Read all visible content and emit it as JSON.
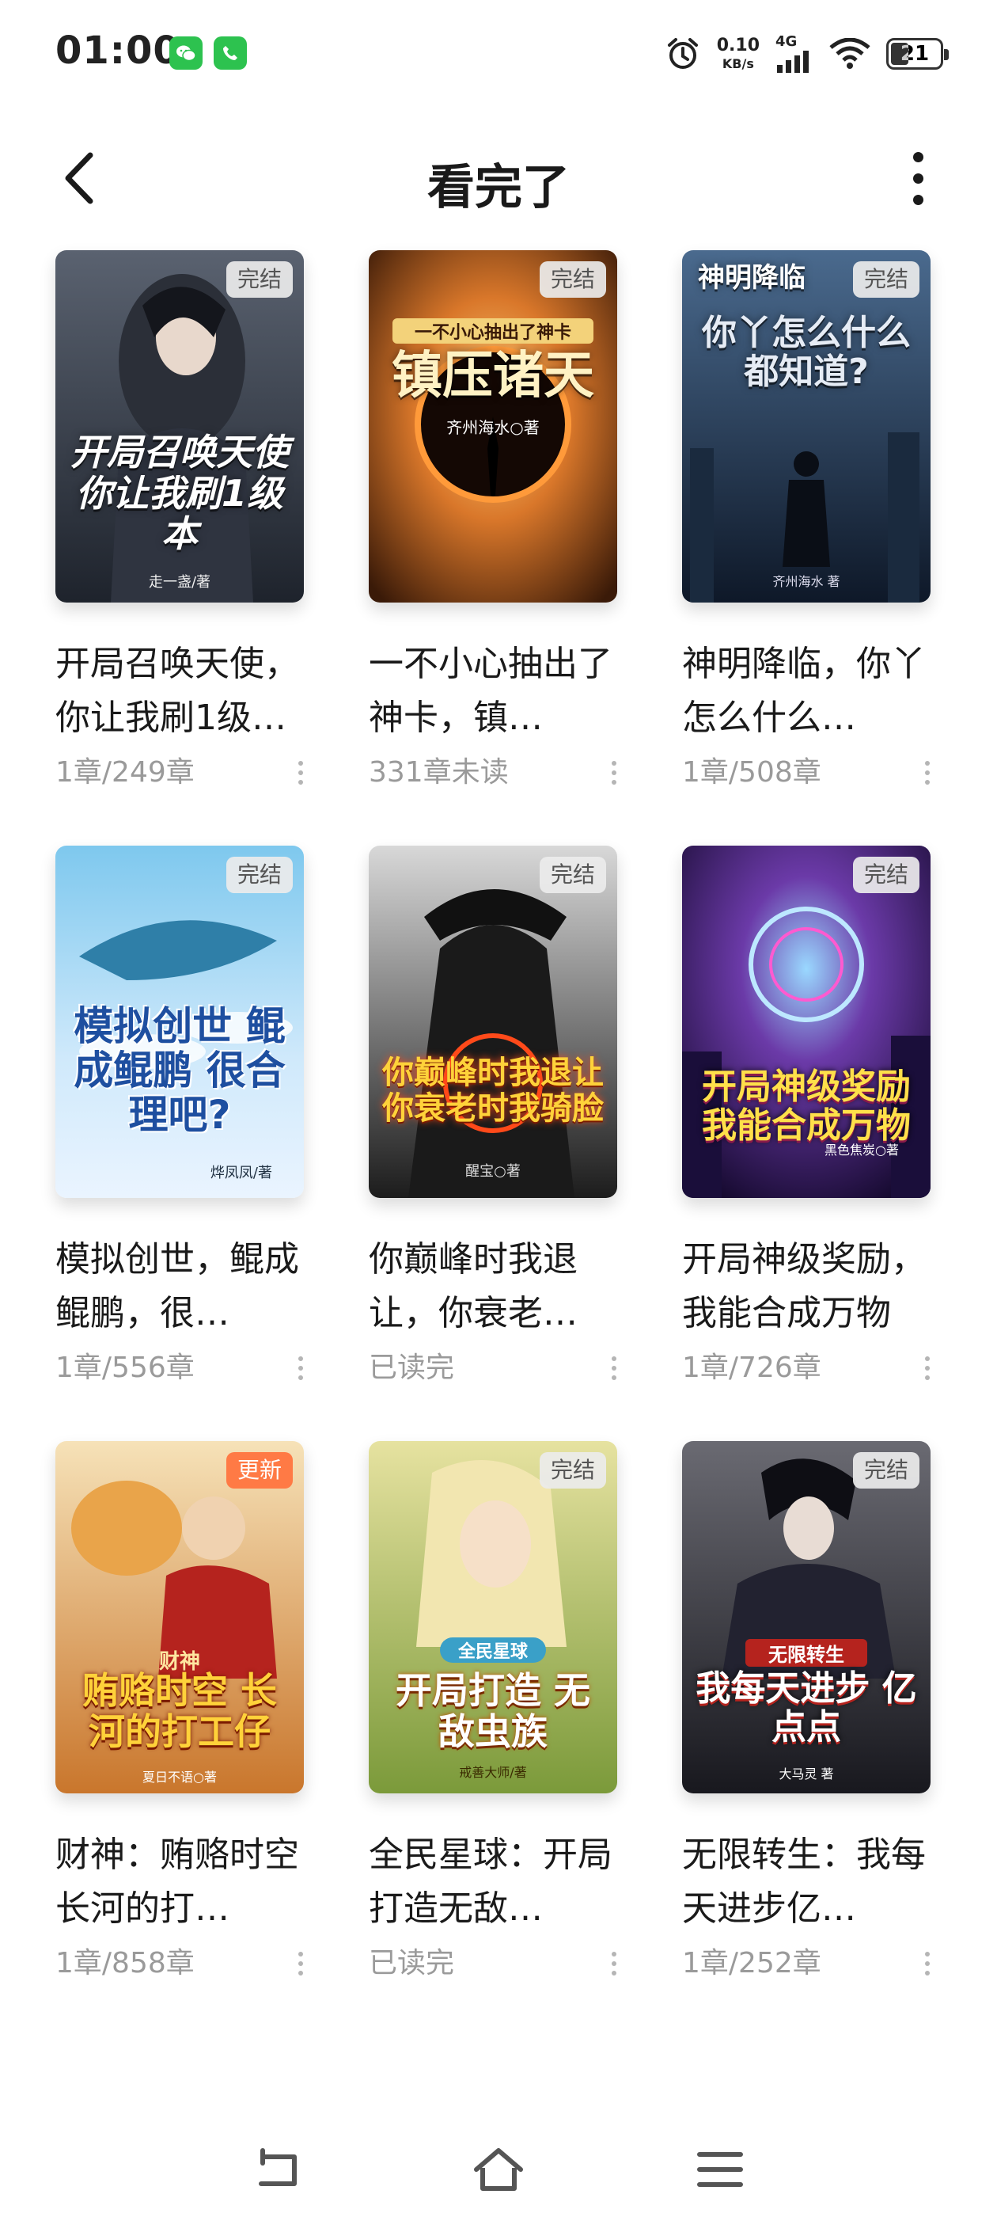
{
  "status_bar": {
    "time": "01:00",
    "net_speed_value": "0.10",
    "net_speed_unit": "KB/s",
    "network": "4G",
    "battery": "21",
    "icons": [
      "wechat-icon",
      "phone-icon",
      "alarm-icon",
      "signal-icon",
      "wifi-icon",
      "battery-icon"
    ]
  },
  "header": {
    "title": "看完了",
    "back_icon": "chevron-left-icon",
    "more_icon": "more-vertical-icon"
  },
  "books": [
    {
      "title": "开局召唤天使，你让我刷1级…",
      "progress": "1章/249章",
      "badge": "完结",
      "cover_text": "开局召唤天使 你让我刷1级本",
      "cover_author": "走一盏/著",
      "cover_colors": [
        "#5a6270",
        "#1e232c"
      ]
    },
    {
      "title": " 一不小心抽出了神卡，镇…",
      "progress": "331章未读",
      "badge": "完结",
      "cover_text": "镇压诸天",
      "cover_top": "一不小心抽出了神卡",
      "cover_author": "齐州海水○著",
      "cover_colors": [
        "#d9772a",
        "#3a1a08"
      ]
    },
    {
      "title": "神明降临，你丫怎么什么…",
      "progress": "1章/508章",
      "badge": "完结",
      "cover_text": "你丫怎么什么都知道?",
      "cover_top": "神明降临",
      "cover_author": "齐州海水 著",
      "cover_colors": [
        "#4a6a8e",
        "#0e1828"
      ]
    },
    {
      "title": "模拟创世，鲲成鲲鹏，很…",
      "progress": "1章/556章",
      "badge": "完结",
      "cover_text": "模拟创世 鲲成鲲鹏 很合理吧?",
      "cover_author": "烨凤凤/著",
      "cover_colors": [
        "#7ec8ee",
        "#eaf4ff"
      ]
    },
    {
      "title": "你巅峰时我退让，你衰老…",
      "progress": "已读完",
      "badge": "完结",
      "cover_text": "你巅峰时我退让 你衰老时我骑脸",
      "cover_author": "醒宝○著",
      "cover_colors": [
        "#c9c9c9",
        "#1c1c1c"
      ]
    },
    {
      "title": "开局神级奖励，我能合成万物",
      "progress": "1章/726章",
      "badge": "完结",
      "cover_text": "开局神级奖励 我能合成万物",
      "cover_author": "黑色焦炭○著",
      "cover_colors": [
        "#6b3aa8",
        "#12082a"
      ]
    },
    {
      "title": "财神：贿赂时空长河的打…",
      "progress": "1章/858章",
      "badge": "更新",
      "cover_text": "贿赂时空 长河的打工仔",
      "cover_top": "财神",
      "cover_author": "夏日不语○著",
      "cover_colors": [
        "#f6e2b8",
        "#c9762c"
      ]
    },
    {
      "title": "全民星球：开局打造无敌…",
      "progress": "已读完",
      "badge": "完结",
      "cover_text": "开局打造 无敌虫族",
      "cover_top": "全民星球",
      "cover_author": "戒善大师/著",
      "cover_colors": [
        "#e6e2a0",
        "#7b9a3a"
      ]
    },
    {
      "title": "无限转生：我每天进步亿…",
      "progress": "1章/252章",
      "badge": "完结",
      "cover_text": "我每天进步 亿点点",
      "cover_top": "无限转生",
      "cover_author": "大马灵 著",
      "cover_colors": [
        "#6a6a72",
        "#18181e"
      ]
    }
  ],
  "nav_bar": {
    "icons": [
      "back-icon",
      "home-icon",
      "menu-icon"
    ]
  },
  "colors": {
    "badge_done_bg": "#ebebeb",
    "badge_update_bg": "#ff7a45",
    "meta_text": "#9a9a9a"
  }
}
